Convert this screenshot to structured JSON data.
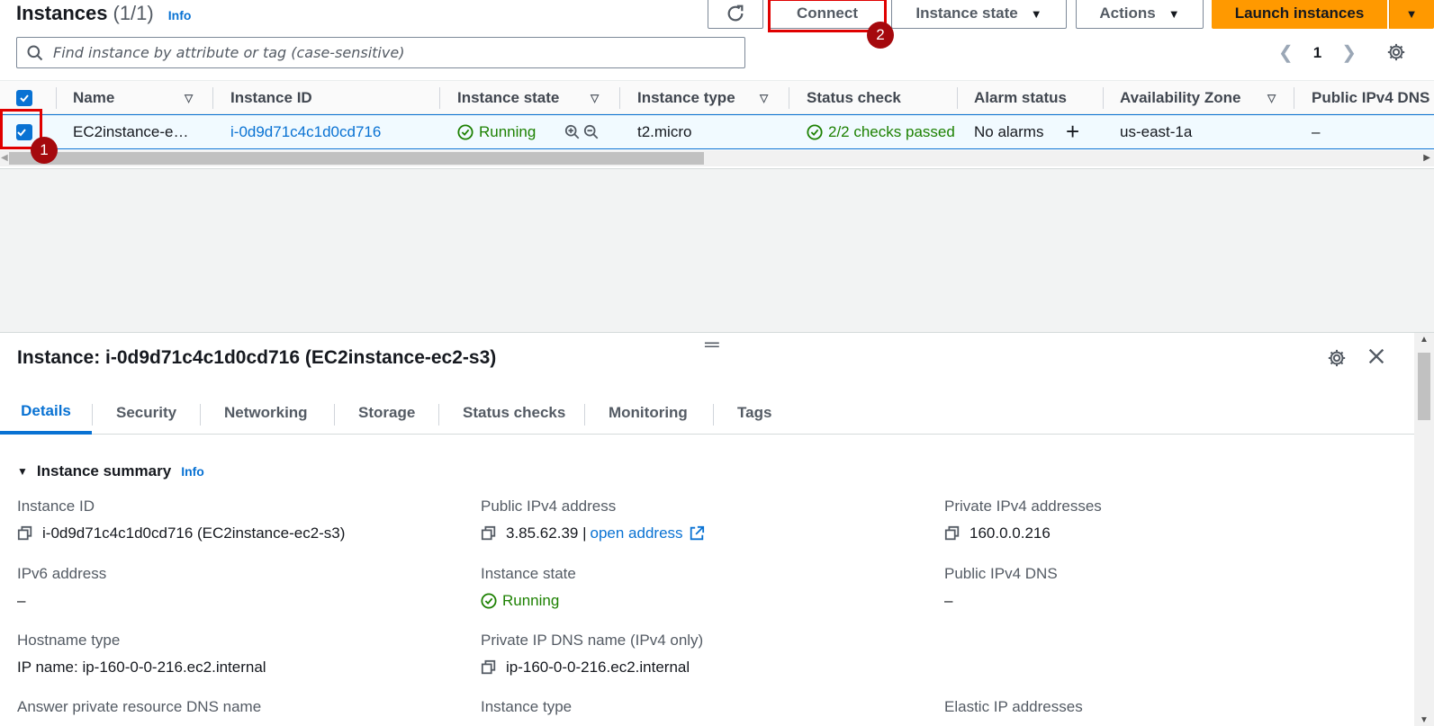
{
  "header": {
    "title": "Instances",
    "count": "(1/1)",
    "info": "Info",
    "search_placeholder": "Find instance by attribute or tag (case-sensitive)"
  },
  "toolbar": {
    "connect": "Connect",
    "instance_state": "Instance state",
    "actions": "Actions",
    "launch": "Launch instances"
  },
  "annotations": {
    "step1": "1",
    "step2": "2",
    "highlight_color": "#e00000"
  },
  "pagination": {
    "current_page": "1"
  },
  "table": {
    "columns": [
      "Name",
      "Instance ID",
      "Instance state",
      "Instance type",
      "Status check",
      "Alarm status",
      "Availability Zone",
      "Public IPv4 DNS"
    ],
    "rows": [
      {
        "name": "EC2instance-e…",
        "instance_id": "i-0d9d71c4c1d0cd716",
        "state": "Running",
        "type": "t2.micro",
        "status_check": "2/2 checks passed",
        "alarm": "No alarms",
        "az": "us-east-1a",
        "public_dns": "–"
      }
    ]
  },
  "details": {
    "title": "Instance: i-0d9d71c4c1d0cd716 (EC2instance-ec2-s3)",
    "tabs": [
      "Details",
      "Security",
      "Networking",
      "Storage",
      "Status checks",
      "Monitoring",
      "Tags"
    ],
    "section": "Instance summary",
    "section_info": "Info",
    "fields": {
      "instance_id": {
        "label": "Instance ID",
        "value": "i-0d9d71c4c1d0cd716 (EC2instance-ec2-s3)"
      },
      "public_ipv4": {
        "label": "Public IPv4 address",
        "value": "3.85.62.39 |",
        "link": "open address"
      },
      "private_ipv4": {
        "label": "Private IPv4 addresses",
        "value": "160.0.0.216"
      },
      "ipv6": {
        "label": "IPv6 address",
        "value": "–"
      },
      "instance_state": {
        "label": "Instance state",
        "value": "Running"
      },
      "public_dns": {
        "label": "Public IPv4 DNS",
        "value": "–"
      },
      "hostname_type": {
        "label": "Hostname type",
        "value": "IP name: ip-160-0-0-216.ec2.internal"
      },
      "private_dns": {
        "label": "Private IP DNS name (IPv4 only)",
        "value": "ip-160-0-0-216.ec2.internal"
      },
      "answer_dns": {
        "label": "Answer private resource DNS name"
      },
      "instance_type": {
        "label": "Instance type"
      },
      "elastic_ip": {
        "label": "Elastic IP addresses"
      }
    }
  },
  "colors": {
    "accent": "#0972d3",
    "success": "#1d8102",
    "launch": "#ff9900",
    "badge": "#a5090d"
  }
}
